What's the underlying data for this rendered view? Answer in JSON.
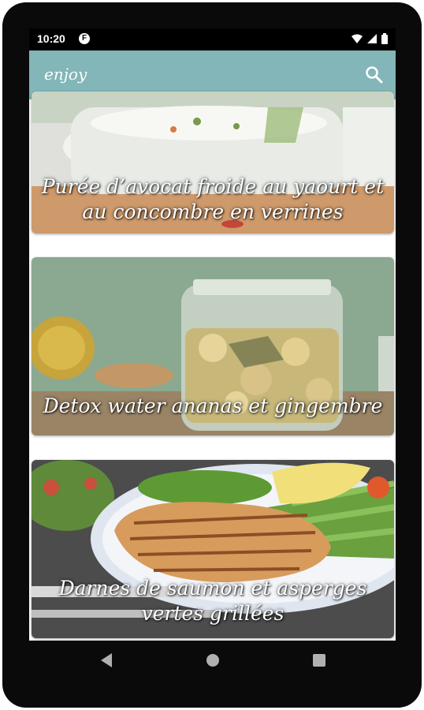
{
  "status": {
    "time": "10:20",
    "notification_badge": "F"
  },
  "appbar": {
    "title": "enjoy",
    "search_icon": "search-icon"
  },
  "recipes": [
    {
      "title": "Purée d’avocat froide au yaourt et au concombre en verrines"
    },
    {
      "title": "Detox water ananas et gingembre"
    },
    {
      "title": "Darnes de saumon et asperges vertes grillées"
    }
  ],
  "navigation": {
    "back_icon": "back-triangle-icon",
    "home_icon": "home-circle-icon",
    "recents_icon": "recents-square-icon"
  },
  "colors": {
    "appbar": "#82b6b8",
    "frame": "#0a0a0a",
    "statusbar": "#000000"
  }
}
